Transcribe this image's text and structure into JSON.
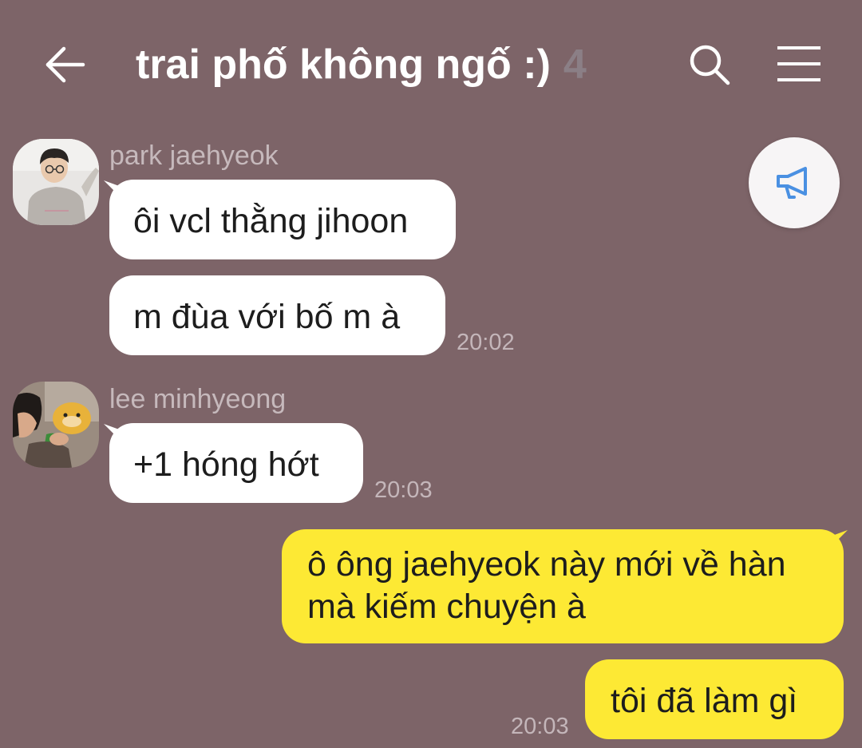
{
  "header": {
    "title": "trai phố không ngố :)",
    "member_count": "4",
    "back_icon": "arrow-left-icon",
    "search_icon": "search-icon",
    "menu_icon": "hamburger-menu-icon"
  },
  "notice_icon": "megaphone-icon",
  "colors": {
    "background": "#7d6468",
    "incoming_bubble": "#ffffff",
    "outgoing_bubble": "#fde934",
    "sender_name": "#c6b9bc",
    "timestamp": "#c4b6ba",
    "member_count": "#8b7f86"
  },
  "messages": [
    {
      "sender": "park jaehyeok",
      "bubbles": [
        "ôi vcl thằng jihoon",
        "m đùa với bố m à"
      ],
      "time": "20:02"
    },
    {
      "sender": "lee minhyeong",
      "bubbles": [
        "+1 hóng hớt"
      ],
      "time": "20:03"
    },
    {
      "sender": "me",
      "bubbles": [
        [
          "ô ông jaehyeok này mới về hàn",
          "mà kiếm chuyện à"
        ],
        "tôi đã làm gì"
      ],
      "time": "20:03"
    }
  ]
}
